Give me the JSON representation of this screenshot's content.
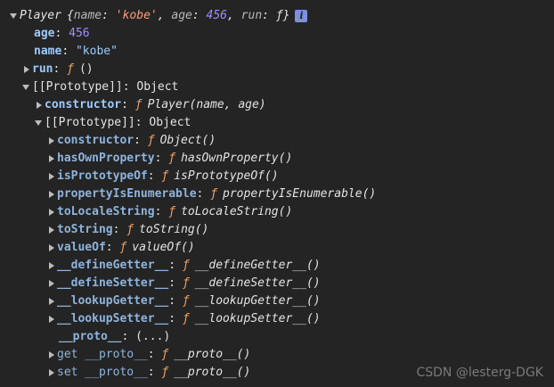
{
  "colors": {
    "background": "#242424",
    "key": "#9ccaff",
    "number": "#9f8eff",
    "string": "#9ccaff",
    "function_symbol": "#f5a062",
    "text": "#e3e3e3",
    "info_badge": "#7d8fe0"
  },
  "root": {
    "label": "Player",
    "preview_open": "{",
    "preview": [
      {
        "key": "name",
        "value": "'kobe'",
        "type": "string"
      },
      {
        "key": "age",
        "value": "456",
        "type": "number"
      },
      {
        "key": "run",
        "value": "ƒ",
        "type": "function"
      }
    ],
    "preview_close": "}",
    "info_icon": "i"
  },
  "props": {
    "age": {
      "key": "age",
      "value": "456"
    },
    "name": {
      "key": "name",
      "value": "\"kobe\""
    },
    "run": {
      "key": "run",
      "fsym": "ƒ",
      "sig": "()"
    }
  },
  "proto1": {
    "key": "[[Prototype]]",
    "value": "Object",
    "constructor": {
      "key": "constructor",
      "fsym": "ƒ",
      "sig": "Player(name, age)"
    }
  },
  "proto2": {
    "key": "[[Prototype]]",
    "value": "Object",
    "items": [
      {
        "key": "constructor",
        "fsym": "ƒ",
        "sig": "Object()"
      },
      {
        "key": "hasOwnProperty",
        "fsym": "ƒ",
        "sig": "hasOwnProperty()"
      },
      {
        "key": "isPrototypeOf",
        "fsym": "ƒ",
        "sig": "isPrototypeOf()"
      },
      {
        "key": "propertyIsEnumerable",
        "fsym": "ƒ",
        "sig": "propertyIsEnumerable()"
      },
      {
        "key": "toLocaleString",
        "fsym": "ƒ",
        "sig": "toLocaleString()"
      },
      {
        "key": "toString",
        "fsym": "ƒ",
        "sig": "toString()"
      },
      {
        "key": "valueOf",
        "fsym": "ƒ",
        "sig": "valueOf()"
      },
      {
        "key": "__defineGetter__",
        "fsym": "ƒ",
        "sig": "__defineGetter__()"
      },
      {
        "key": "__defineSetter__",
        "fsym": "ƒ",
        "sig": "__defineSetter__()"
      },
      {
        "key": "__lookupGetter__",
        "fsym": "ƒ",
        "sig": "__lookupGetter__()"
      },
      {
        "key": "__lookupSetter__",
        "fsym": "ƒ",
        "sig": "__lookupSetter__()"
      }
    ],
    "proto_accessor": {
      "key": "__proto__",
      "value": "(...)"
    },
    "getter": {
      "key": "get __proto__",
      "fsym": "ƒ",
      "sig": "__proto__()"
    },
    "setter": {
      "key": "set __proto__",
      "fsym": "ƒ",
      "sig": "__proto__()"
    }
  },
  "watermark": "CSDN @lesterg-DGK"
}
